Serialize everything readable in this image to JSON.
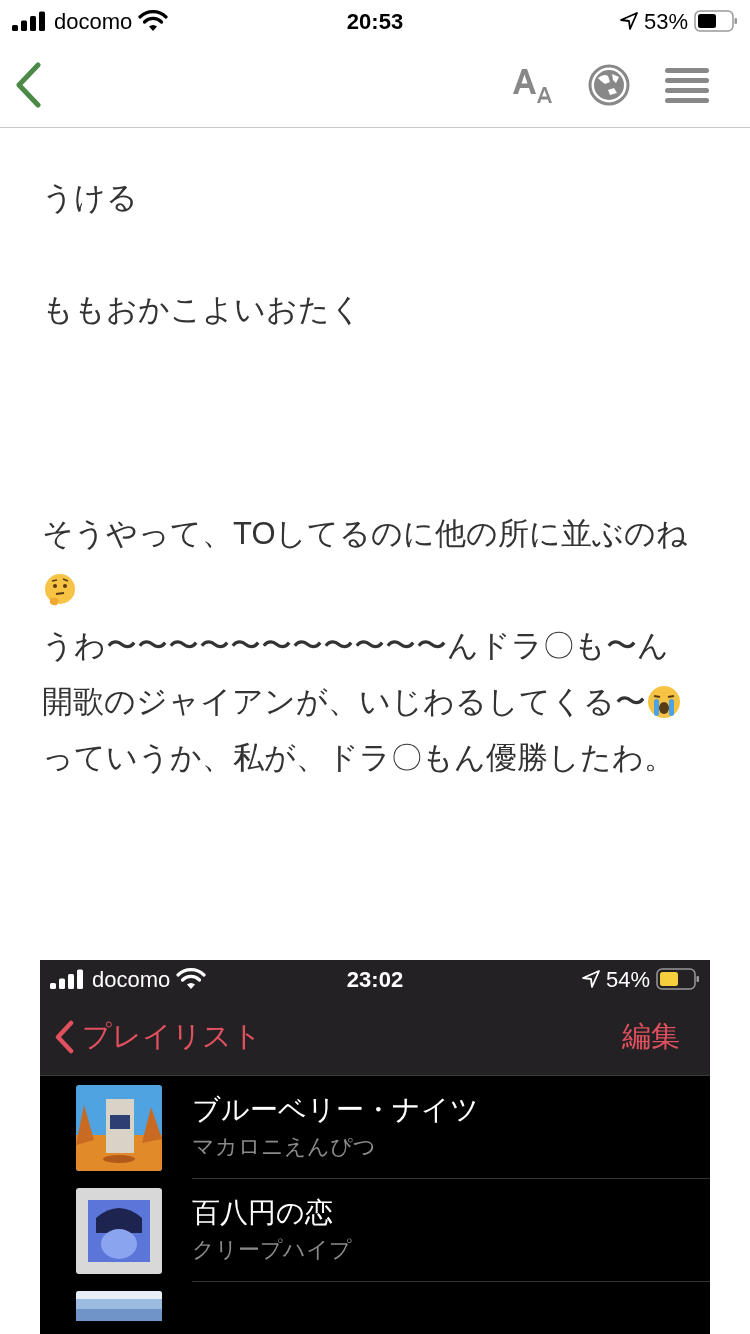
{
  "status_bar": {
    "carrier": "docomo",
    "time": "20:53",
    "battery": "53%"
  },
  "toolbar": {
    "buttons": [
      {
        "kind": "text-size"
      },
      {
        "kind": "globe"
      },
      {
        "kind": "menu"
      }
    ]
  },
  "post": {
    "paragraphs": [
      {
        "lines": [
          {
            "text": "うける"
          }
        ]
      },
      {
        "lines": [
          {
            "text": "ももおかこよいおたく"
          }
        ]
      },
      {
        "lines": [
          {
            "text": "そうやって、TOしてるのに他の所に並ぶのね"
          },
          {
            "emoji": {
              "kind": "thinking"
            }
          },
          {
            "text": "うわ〜〜〜〜〜〜〜〜〜〜〜んドラ〇も〜ん"
          },
          {
            "text": "開歌のジャイアンが、いじわるしてくる〜",
            "emoji": {
              "kind": "crying"
            }
          },
          {
            "text": "っていうか、私が、ドラ〇もん優勝したわ。"
          }
        ]
      }
    ]
  },
  "screenshot": {
    "status_bar": {
      "carrier": "docomo",
      "time": "23:02",
      "battery": "54%"
    },
    "nav": {
      "back": "プレイリスト",
      "edit": "編集"
    },
    "songs": [
      {
        "title": "ブルーベリー・ナイツ",
        "artist": "マカロニえんぴつ",
        "kind": "picture"
      },
      {
        "title": "百八円の恋",
        "artist": "クリープハイプ",
        "kind": "picture"
      },
      {
        "kind": "picture"
      }
    ]
  }
}
